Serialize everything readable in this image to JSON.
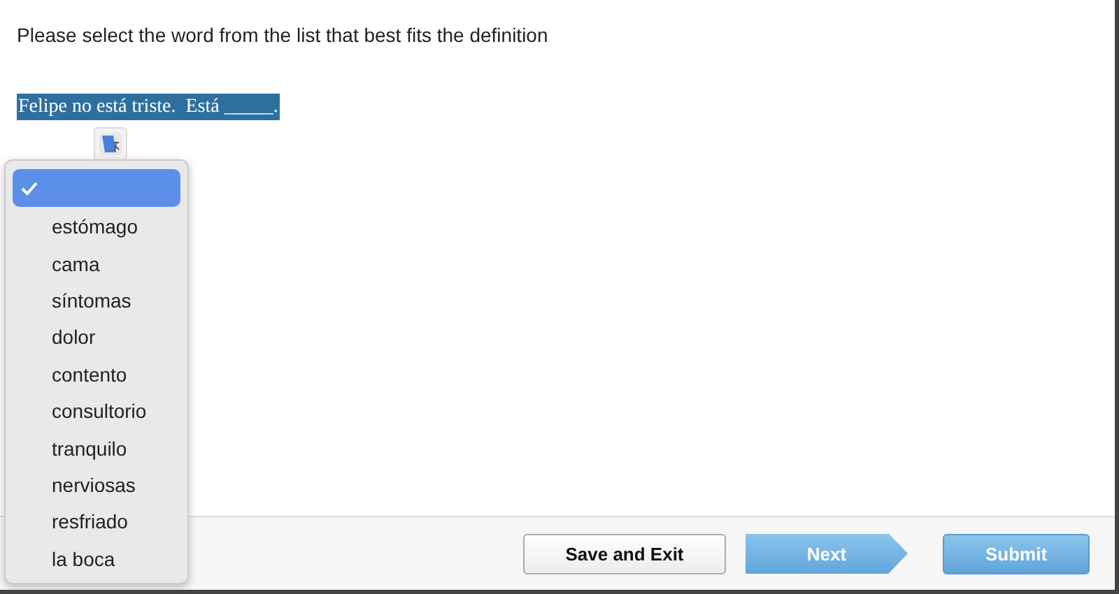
{
  "instruction": "Please select the word from the list that best fits the definition",
  "sentence": "Felipe no está triste.  Está _____.",
  "dropdown": {
    "options": [
      {
        "selected": true
      },
      {
        "label": "estómago",
        "selected": false
      },
      {
        "label": "cama",
        "selected": false
      },
      {
        "label": "síntomas",
        "selected": false
      },
      {
        "label": "dolor",
        "selected": false
      },
      {
        "label": "contento",
        "selected": false
      },
      {
        "label": "consultorio",
        "selected": false
      },
      {
        "label": "tranquilo",
        "selected": false
      },
      {
        "label": "nerviosas",
        "selected": false
      },
      {
        "label": "resfriado",
        "selected": false
      },
      {
        "label": "la boca",
        "selected": false
      }
    ]
  },
  "buttons": [
    {
      "label": "Save and Exit",
      "kind": "plain"
    },
    {
      "label": "Next",
      "kind": "arrow"
    },
    {
      "label": "Submit",
      "kind": "primary"
    }
  ]
}
